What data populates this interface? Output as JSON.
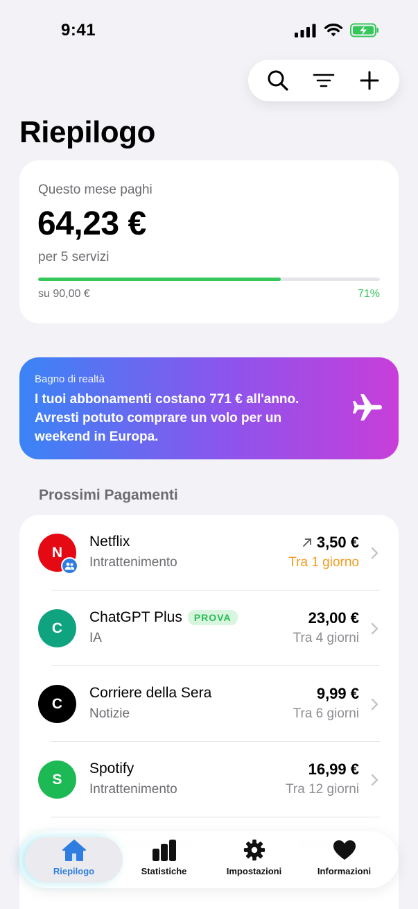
{
  "status_bar": {
    "time": "9:41"
  },
  "toolbar": {
    "search_icon": "search-icon",
    "filter_icon": "filter-icon",
    "add_icon": "plus-icon"
  },
  "page": {
    "title": "Riepilogo"
  },
  "summary": {
    "label": "Questo mese paghi",
    "amount": "64,23 €",
    "services": "per 5 servizi",
    "budget": "su 90,00 €",
    "percent": "71%",
    "progress": 0.71,
    "progress_color": "#34c759"
  },
  "reality_check": {
    "kicker": "Bagno di realtà",
    "message": "I tuoi abbonamenti costano 771 € all'anno. Avresti potuto comprare un volo per un weekend in Europa.",
    "icon": "airplane-icon",
    "gradient": [
      "#3a84f6",
      "#8d54ec",
      "#c83ed9"
    ]
  },
  "payments": {
    "section_title": "Prossimi Pagamenti",
    "items": [
      {
        "initial": "N",
        "name": "Netflix",
        "category": "Intrattenimento",
        "amount": "3,50 €",
        "due": "Tra 1 giorno",
        "avatar_color": "#e50914",
        "shared": true,
        "trend_icon": "arrow-up-right-icon"
      },
      {
        "initial": "C",
        "name": "ChatGPT Plus",
        "badge": "PROVA",
        "category": "IA",
        "amount": "23,00 €",
        "due": "Tra 4 giorni",
        "avatar_color": "#10a37f"
      },
      {
        "initial": "C",
        "name": "Corriere della Sera",
        "category": "Notizie",
        "amount": "9,99 €",
        "due": "Tra 6 giorni",
        "avatar_color": "#000000"
      },
      {
        "initial": "S",
        "name": "Spotify",
        "category": "Intrattenimento",
        "amount": "16,99 €",
        "due": "Tra 12 giorni",
        "avatar_color": "#1db954"
      }
    ]
  },
  "tabs": [
    {
      "label": "Riepilogo",
      "icon": "home-icon",
      "active": true
    },
    {
      "label": "Statistiche",
      "icon": "bar-chart-icon"
    },
    {
      "label": "Impostazioni",
      "icon": "gear-icon"
    },
    {
      "label": "Informazioni",
      "icon": "heart-icon"
    }
  ],
  "colors": {
    "accent": "#2f7de1",
    "due_soon": "#f39a1b",
    "background": "#f2f2f7"
  }
}
